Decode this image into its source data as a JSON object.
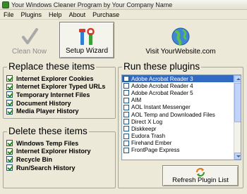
{
  "window": {
    "title": "Your Windows Cleaner Program by Your Company Name"
  },
  "menu": [
    "File",
    "Plugins",
    "Help",
    "About",
    "Purchase"
  ],
  "toolbar": {
    "clean_label": "Clean  Now",
    "setup_label": "Setup Wizard",
    "visit_label": "Visit YourWebsite.com"
  },
  "replace": {
    "title": "Replace these items",
    "items": [
      {
        "label": "Internet Explorer Cookies",
        "checked": true
      },
      {
        "label": "Internet Explorer Typed URLs",
        "checked": true
      },
      {
        "label": "Temporary Internet Files",
        "checked": true
      },
      {
        "label": "Document History",
        "checked": true
      },
      {
        "label": "Media Player History",
        "checked": true
      }
    ]
  },
  "delete": {
    "title": "Delete these items",
    "items": [
      {
        "label": "Windows Temp Files",
        "checked": true
      },
      {
        "label": "Internet Explorer History",
        "checked": true
      },
      {
        "label": "Recycle Bin",
        "checked": true
      },
      {
        "label": "Run/Search History",
        "checked": true
      }
    ]
  },
  "plugins": {
    "title": "Run these plugins",
    "items": [
      {
        "label": "Adobe Acrobat Reader 3",
        "checked": false,
        "selected": true
      },
      {
        "label": "Adobe Acrobat Reader 4",
        "checked": false
      },
      {
        "label": "Adobe Acrobat Reader 5",
        "checked": false
      },
      {
        "label": "AIM",
        "checked": false
      },
      {
        "label": "AOL Instant Messenger",
        "checked": false
      },
      {
        "label": "AOL Temp and Downloaded Files",
        "checked": false
      },
      {
        "label": "Direct X Log",
        "checked": false
      },
      {
        "label": "Diskkeepr",
        "checked": false
      },
      {
        "label": "Eudora Trash",
        "checked": false
      },
      {
        "label": "Firehand Ember",
        "checked": false
      },
      {
        "label": "FrontPage Express",
        "checked": false
      }
    ],
    "refresh_label": "Refresh Plugin List"
  }
}
